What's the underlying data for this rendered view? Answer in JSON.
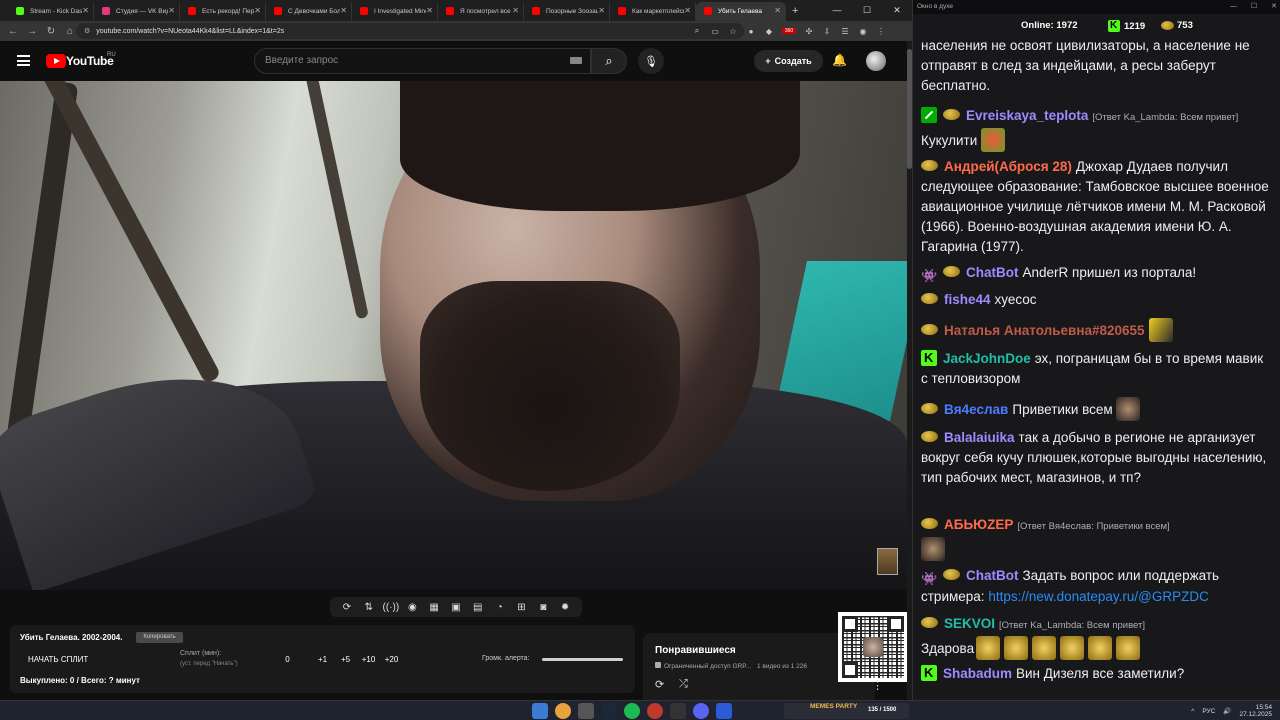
{
  "browser": {
    "tabs": [
      {
        "label": "Stream - Kick Dash",
        "color": "#53fc18"
      },
      {
        "label": "Студия — VK Видео",
        "color": "#e03a7a"
      },
      {
        "label": "Есть рекорд! Перекл",
        "color": "#ff0000"
      },
      {
        "label": "С Девочками Боль",
        "color": "#ff0000"
      },
      {
        "label": "I Investigated Minec",
        "color": "#ff0000"
      },
      {
        "label": "Я посмотрел все ф",
        "color": "#ff0000"
      },
      {
        "label": "Позорные Зоозащ",
        "color": "#ff0000"
      },
      {
        "label": "Как маркетплейсы",
        "color": "#ff0000"
      },
      {
        "label": "Убить Гелаева",
        "color": "#ff0000",
        "active": true
      }
    ],
    "url": "youtube.com/watch?v=NUeota44Kk4&list=LL&index=1&t=2s",
    "ext_badge": "360"
  },
  "youtube": {
    "logo_text": "YouTube",
    "region": "RU",
    "search_placeholder": "Введите запрос",
    "create_label": "Создать"
  },
  "split": {
    "title": "Убить Гелаева. 2002-2004.",
    "copy_label": "Копировать",
    "start_label": "НАЧАТЬ СПЛИТ",
    "split_label": "Сплит (мин):",
    "split_hint": "(уст. перед \"Начать\")",
    "values": [
      "0",
      "+1",
      "+5",
      "+10",
      "+20"
    ],
    "alert_label": "Громк. алерта:",
    "alert_volume": 1.0,
    "completed": "Выкуплено: 0 / Всего: ? минут"
  },
  "liked": {
    "title": "Понравившиеся",
    "access": "Ограниченный доступ",
    "owner": "GRP...",
    "count": "1 видео из 1 226"
  },
  "chat": {
    "window_title": "Окно в духе",
    "online_label": "Online:",
    "online_count": "1972",
    "kick_count": "1219",
    "emote_count": "753",
    "messages": [
      {
        "user": "",
        "color": "#efeff1",
        "reply": "",
        "text": "населения не освоят цивилизаторы, а  население не отправят в след за индейцами, а ресы заберут бесплатно."
      },
      {
        "user": "Evreiskaya_teplota",
        "color": "#9b8cff",
        "reply": "[Ответ Ka_Lambda: Всем привет]",
        "text": "Кукулити"
      },
      {
        "user": "Андрей(Аброся 28)",
        "color": "#ff6b4a",
        "reply": "",
        "text": "Джохар Дудаев получил следующее образование: Тамбовское высшее военное авиационное училище лётчиков имени М. М. Расковой (1966). Военно-воздушная академия имени Ю. А. Гагарина (1977)."
      },
      {
        "user": "ChatBot",
        "color": "#9b8cff",
        "reply": "",
        "text": "AnderR пришел из портала!"
      },
      {
        "user": "fishe44",
        "color": "#9b8cff",
        "reply": "",
        "text": "хуесос"
      },
      {
        "user": "Наталья Анатольевна#820655",
        "color": "#c05a4a",
        "reply": "",
        "text": ""
      },
      {
        "user": "JackJohnDoe",
        "color": "#1fbfa8",
        "reply": "",
        "text": "эх, пограницам бы в то время мавик с тепловизором"
      },
      {
        "user": "Вя4еслав",
        "color": "#4a7dff",
        "reply": "",
        "text": "Приветики всем"
      },
      {
        "user": "Balalaiuika",
        "color": "#9b8cff",
        "reply": "",
        "text": "так а добычо в регионе не арганизует вокруг себя кучу плюшек,которые выгодны населению, тип рабочих мест, магазинов, и тп?"
      },
      {
        "user": "АБЬЮZEP",
        "color": "#ff6b4a",
        "reply": "[Ответ Вя4еслав: Приветики всем]",
        "text": ""
      },
      {
        "user": "ChatBot",
        "color": "#9b8cff",
        "reply": "",
        "text": "Задать вопрос или поддержать стримера:",
        "link": "https://new.donatepay.ru/@GRPZDC"
      },
      {
        "user": "SEKVOI",
        "color": "#1fbfa8",
        "reply": "[Ответ Ka_Lambda: Всем привет]",
        "text": "Здарова"
      },
      {
        "user": "Shabadum",
        "color": "#9b8cff",
        "reply": "",
        "text": "Вин Дизеля все заметили?"
      }
    ]
  },
  "taskbar": {
    "meme_label": "MEMES PARTY",
    "meme_count": "135 / 1500",
    "lang": "РУС",
    "time": "15:54",
    "date": "27.12.2025"
  }
}
